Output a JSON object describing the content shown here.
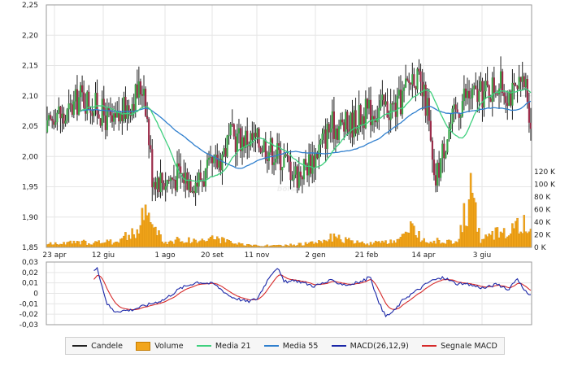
{
  "chart_data": {
    "type": "candlestick",
    "watermark": "borsa",
    "price_axis": {
      "ticks": [
        "2,25",
        "2,20",
        "2,15",
        "2,10",
        "2,05",
        "2,00",
        "1,95",
        "1,90",
        "1,85"
      ],
      "ylim": [
        1.85,
        2.25
      ]
    },
    "volume_axis": {
      "ticks": [
        "120 K",
        "100 K",
        "80 K",
        "60 K",
        "40 K",
        "20 K",
        "0 K"
      ],
      "ylim": [
        0,
        120000
      ]
    },
    "macd_axis": {
      "ticks": [
        "0,03",
        "0,02",
        "0,01",
        "0",
        "-0,01",
        "-0,02",
        "-0,03"
      ],
      "ylim": [
        -0.03,
        0.03
      ]
    },
    "x_ticks": [
      "23 apr",
      "12 giu",
      "1 ago",
      "20 set",
      "11 nov",
      "2 gen",
      "21 feb",
      "14 apr",
      "3 giu"
    ],
    "colors": {
      "up": "#3aa64a",
      "down": "#9b2c4a",
      "volume": "#f2a51b",
      "ma21": "#3fd07e",
      "ma55": "#2f7fce",
      "macd": "#1b27a8",
      "signal": "#d62a2a",
      "wick": "#222222"
    },
    "price_keypoints": [
      {
        "x": 0,
        "y": 2.04
      },
      {
        "x": 5,
        "y": 2.08
      },
      {
        "x": 10,
        "y": 2.06
      },
      {
        "x": 20,
        "y": 2.1
      },
      {
        "x": 30,
        "y": 2.08
      },
      {
        "x": 40,
        "y": 2.05
      },
      {
        "x": 50,
        "y": 2.09
      },
      {
        "x": 58,
        "y": 2.12
      },
      {
        "x": 63,
        "y": 1.97
      },
      {
        "x": 70,
        "y": 1.96
      },
      {
        "x": 80,
        "y": 1.97
      },
      {
        "x": 90,
        "y": 1.96
      },
      {
        "x": 100,
        "y": 1.98
      },
      {
        "x": 110,
        "y": 2.03
      },
      {
        "x": 120,
        "y": 2.03
      },
      {
        "x": 130,
        "y": 2.02
      },
      {
        "x": 140,
        "y": 2.0
      },
      {
        "x": 150,
        "y": 1.97
      },
      {
        "x": 160,
        "y": 2.0
      },
      {
        "x": 170,
        "y": 2.05
      },
      {
        "x": 180,
        "y": 2.05
      },
      {
        "x": 190,
        "y": 2.07
      },
      {
        "x": 200,
        "y": 2.08
      },
      {
        "x": 210,
        "y": 2.08
      },
      {
        "x": 220,
        "y": 2.14
      },
      {
        "x": 228,
        "y": 2.08
      },
      {
        "x": 232,
        "y": 1.95
      },
      {
        "x": 240,
        "y": 2.04
      },
      {
        "x": 250,
        "y": 2.1
      },
      {
        "x": 260,
        "y": 2.1
      },
      {
        "x": 270,
        "y": 2.12
      },
      {
        "x": 280,
        "y": 2.1
      },
      {
        "x": 287,
        "y": 2.12
      },
      {
        "x": 290,
        "y": 2.06
      }
    ],
    "volume_keypoints": [
      {
        "x": 0,
        "y": 6000
      },
      {
        "x": 20,
        "y": 9000
      },
      {
        "x": 40,
        "y": 10000
      },
      {
        "x": 48,
        "y": 22000
      },
      {
        "x": 52,
        "y": 24000
      },
      {
        "x": 54,
        "y": 28000
      },
      {
        "x": 60,
        "y": 75000
      },
      {
        "x": 62,
        "y": 45000
      },
      {
        "x": 70,
        "y": 9000
      },
      {
        "x": 80,
        "y": 14000
      },
      {
        "x": 90,
        "y": 12000
      },
      {
        "x": 100,
        "y": 18000
      },
      {
        "x": 110,
        "y": 8000
      },
      {
        "x": 120,
        "y": 4000
      },
      {
        "x": 140,
        "y": 3000
      },
      {
        "x": 160,
        "y": 8000
      },
      {
        "x": 170,
        "y": 18000
      },
      {
        "x": 190,
        "y": 7000
      },
      {
        "x": 210,
        "y": 10000
      },
      {
        "x": 220,
        "y": 38000
      },
      {
        "x": 225,
        "y": 14000
      },
      {
        "x": 245,
        "y": 9000
      },
      {
        "x": 255,
        "y": 102000
      },
      {
        "x": 260,
        "y": 12000
      },
      {
        "x": 270,
        "y": 28000
      },
      {
        "x": 280,
        "y": 38000
      },
      {
        "x": 285,
        "y": 46000
      },
      {
        "x": 290,
        "y": 30000
      }
    ],
    "macd_keypoints": [
      {
        "x": 0,
        "y": 0.003
      },
      {
        "x": 5,
        "y": 0.006
      },
      {
        "x": 10,
        "y": 0.0
      },
      {
        "x": 15,
        "y": -0.005
      },
      {
        "x": 20,
        "y": 0.006
      },
      {
        "x": 25,
        "y": 0.013
      },
      {
        "x": 30,
        "y": 0.026
      },
      {
        "x": 32,
        "y": 0.012
      },
      {
        "x": 36,
        "y": -0.01
      },
      {
        "x": 40,
        "y": -0.017
      },
      {
        "x": 50,
        "y": -0.016
      },
      {
        "x": 60,
        "y": -0.011
      },
      {
        "x": 70,
        "y": -0.006
      },
      {
        "x": 80,
        "y": 0.005
      },
      {
        "x": 90,
        "y": 0.011
      },
      {
        "x": 100,
        "y": 0.009
      },
      {
        "x": 110,
        "y": -0.003
      },
      {
        "x": 120,
        "y": -0.008
      },
      {
        "x": 126,
        "y": -0.005
      },
      {
        "x": 134,
        "y": 0.018
      },
      {
        "x": 138,
        "y": 0.025
      },
      {
        "x": 142,
        "y": 0.011
      },
      {
        "x": 150,
        "y": 0.012
      },
      {
        "x": 160,
        "y": 0.007
      },
      {
        "x": 170,
        "y": 0.012
      },
      {
        "x": 180,
        "y": 0.008
      },
      {
        "x": 188,
        "y": 0.011
      },
      {
        "x": 194,
        "y": 0.016
      },
      {
        "x": 198,
        "y": -0.006
      },
      {
        "x": 203,
        "y": -0.022
      },
      {
        "x": 208,
        "y": -0.017
      },
      {
        "x": 214,
        "y": -0.005
      },
      {
        "x": 222,
        "y": 0.003
      },
      {
        "x": 230,
        "y": 0.012
      },
      {
        "x": 238,
        "y": 0.015
      },
      {
        "x": 246,
        "y": 0.009
      },
      {
        "x": 254,
        "y": 0.008
      },
      {
        "x": 262,
        "y": 0.005
      },
      {
        "x": 270,
        "y": 0.009
      },
      {
        "x": 276,
        "y": 0.003
      },
      {
        "x": 282,
        "y": 0.015
      },
      {
        "x": 286,
        "y": 0.002
      },
      {
        "x": 290,
        "y": -0.001
      }
    ]
  },
  "legend": [
    {
      "label": "Candele",
      "color": "#222222",
      "kind": "line"
    },
    {
      "label": "Volume",
      "color": "#f2a51b",
      "kind": "volume"
    },
    {
      "label": "Media 21",
      "color": "#3fd07e",
      "kind": "line"
    },
    {
      "label": "Media 55",
      "color": "#2f7fce",
      "kind": "line"
    },
    {
      "label": "MACD(26,12,9)",
      "color": "#1b27a8",
      "kind": "line"
    },
    {
      "label": "Segnale MACD",
      "color": "#d62a2a",
      "kind": "line"
    }
  ]
}
